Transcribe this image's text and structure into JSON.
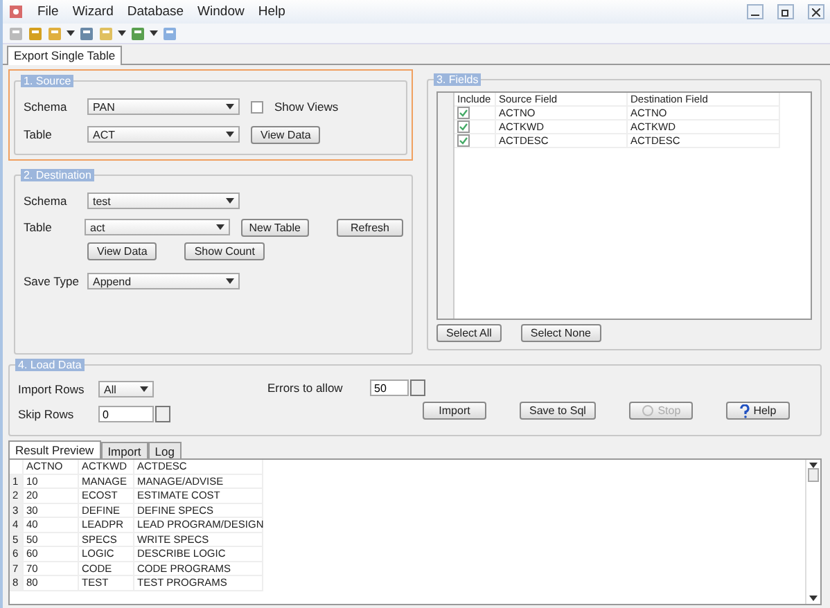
{
  "menu": [
    "File",
    "Wizard",
    "Database",
    "Window",
    "Help"
  ],
  "tabs": [
    {
      "label": "Export Single Table",
      "selected": true
    }
  ],
  "source": {
    "title": "1. Source",
    "focused": true,
    "schema": {
      "label": "Schema",
      "value": "PAN"
    },
    "table": {
      "label": "Table",
      "value": "ACT"
    },
    "show_views": {
      "label": "Show Views",
      "checked": false
    },
    "view_data": "View Data"
  },
  "destination": {
    "title": "2. Destination",
    "schema": {
      "label": "Schema",
      "value": "test"
    },
    "table": {
      "label": "Table",
      "value": "act"
    },
    "buttons": [
      "New Table",
      "Refresh"
    ],
    "buttons_2": [
      "View Data",
      "Show Count"
    ],
    "save_type": {
      "label": "Save Type",
      "value": "Append"
    }
  },
  "fields": {
    "title": "3. Fields",
    "columns": [
      "Include",
      "Source Field",
      "Destination Field"
    ],
    "rows": [
      {
        "include": true,
        "source": "ACTNO",
        "destination": "ACTNO"
      },
      {
        "include": true,
        "source": "ACTKWD",
        "destination": "ACTKWD"
      },
      {
        "include": true,
        "source": "ACTDESC",
        "destination": "ACTDESC"
      }
    ],
    "buttons": [
      "Select All",
      "Select None"
    ]
  },
  "load_data": {
    "title": "4. Load Data",
    "import_rows": {
      "label": "Import Rows",
      "value": "All"
    },
    "skip_rows": {
      "label": "Skip Rows",
      "value": "0"
    },
    "errors": {
      "label": "Errors to allow",
      "value": "50"
    },
    "buttons": [
      {
        "label": "Import",
        "kind": "plain",
        "disabled": false
      },
      {
        "label": "Save to Sql",
        "kind": "plain",
        "disabled": false
      },
      {
        "label": "Stop",
        "kind": "stop",
        "disabled": true
      },
      {
        "label": "Help",
        "kind": "help",
        "disabled": false
      }
    ]
  },
  "bottom_tabs": [
    {
      "label": "Result Preview",
      "selected": true
    },
    {
      "label": "Import",
      "selected": false
    },
    {
      "label": "Log",
      "selected": false
    }
  ],
  "preview": {
    "columns": [
      "ACTNO",
      "ACTKWD",
      "ACTDESC"
    ],
    "rows": [
      {
        "number": "1",
        "cells": [
          "10",
          "MANAGE",
          "MANAGE/ADVISE"
        ]
      },
      {
        "number": "2",
        "cells": [
          "20",
          "ECOST",
          "ESTIMATE COST"
        ]
      },
      {
        "number": "3",
        "cells": [
          "30",
          "DEFINE",
          "DEFINE SPECS"
        ]
      },
      {
        "number": "4",
        "cells": [
          "40",
          "LEADPR",
          "LEAD PROGRAM/DESIGN"
        ]
      },
      {
        "number": "5",
        "cells": [
          "50",
          "SPECS",
          "WRITE SPECS"
        ]
      },
      {
        "number": "6",
        "cells": [
          "60",
          "LOGIC",
          "DESCRIBE LOGIC"
        ]
      },
      {
        "number": "7",
        "cells": [
          "70",
          "CODE",
          "CODE PROGRAMS"
        ]
      },
      {
        "number": "8",
        "cells": [
          "80",
          "TEST",
          "TEST PROGRAMS"
        ]
      }
    ]
  }
}
